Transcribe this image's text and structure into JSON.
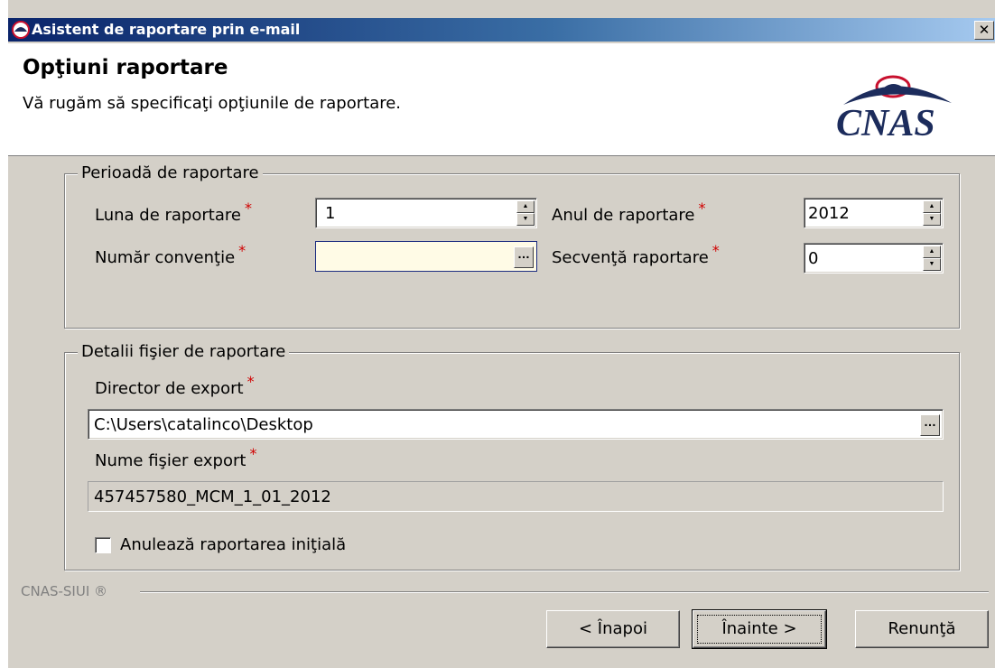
{
  "window": {
    "title": "Asistent de raportare prin e-mail",
    "close_label": "✕"
  },
  "header": {
    "title": "Opţiuni raportare",
    "subtitle": "Vă rugăm să specificaţi opţiunile de raportare.",
    "logo_text": "CNAS"
  },
  "period_group": {
    "legend": "Perioadă de raportare",
    "month_label": "Luna de raportare",
    "month_value": "1",
    "year_label": "Anul de raportare",
    "year_value": "2012",
    "convention_label": "Număr convenţie",
    "convention_value": "",
    "sequence_label": "Secvenţă raportare",
    "sequence_value": "0",
    "required_mark": "*"
  },
  "file_group": {
    "legend": "Detalii fişier de raportare",
    "dir_label": "Director de export",
    "dir_value": "C:\\Users\\catalinco\\Desktop",
    "filename_label": "Nume fişier export",
    "filename_value": "457457580_MCM_1_01_2012",
    "cancel_initial_label": "Anulează raportarea iniţială",
    "cancel_initial_checked": false
  },
  "footer": {
    "brand": "CNAS-SIUI ®",
    "back_label": "< Înapoi",
    "next_label": "Înainte >",
    "cancel_label": "Renunţă"
  },
  "colors": {
    "title_gradient_start": "#0a246a",
    "title_gradient_end": "#a6caf0",
    "required": "#d00000",
    "logo_red": "#c8102e",
    "logo_navy": "#1c2c5c"
  },
  "icons": {
    "app": "cnas-app-icon",
    "close": "close-icon",
    "spin": "spin-arrows-icon",
    "browse": "browse-ellipsis-icon"
  }
}
